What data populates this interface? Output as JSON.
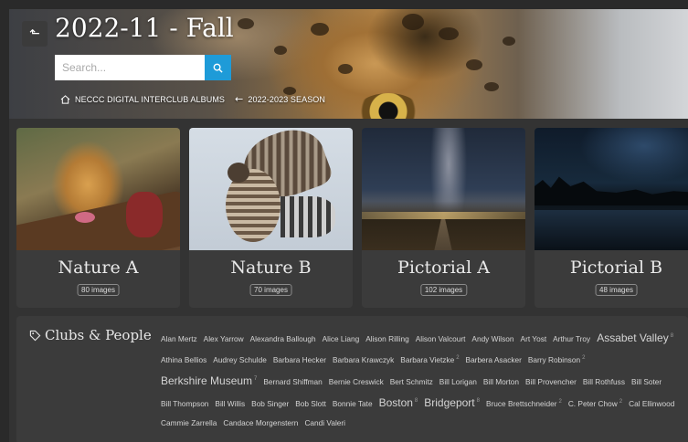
{
  "header": {
    "title": "2022-11 - Fall",
    "back_icon": "arrow-up-left-icon",
    "search_placeholder": "Search...",
    "breadcrumb": {
      "home_label": "NECCC DIGITAL INTERCLUB ALBUMS",
      "parent_label": "2022-2023 SEASON"
    }
  },
  "albums": [
    {
      "name": "Nature A",
      "count": "80 images"
    },
    {
      "name": "Nature B",
      "count": "70 images"
    },
    {
      "name": "Pictorial A",
      "count": "102 images"
    },
    {
      "name": "Pictorial B",
      "count": "48 images"
    }
  ],
  "clubs": {
    "heading": "Clubs & People",
    "tags": [
      {
        "label": "Alan Mertz",
        "count": "",
        "large": false
      },
      {
        "label": "Alex Yarrow",
        "count": "",
        "large": false
      },
      {
        "label": "Alexandra Ballough",
        "count": "",
        "large": false
      },
      {
        "label": "Alice Liang",
        "count": "",
        "large": false
      },
      {
        "label": "Alison Rilling",
        "count": "",
        "large": false
      },
      {
        "label": "Alison Valcourt",
        "count": "",
        "large": false
      },
      {
        "label": "Andy Wilson",
        "count": "",
        "large": false
      },
      {
        "label": "Art Yost",
        "count": "",
        "large": false
      },
      {
        "label": "Arthur Troy",
        "count": "",
        "large": false
      },
      {
        "label": "Assabet Valley",
        "count": "8",
        "large": true
      },
      {
        "label": "Athina Bellios",
        "count": "",
        "large": false
      },
      {
        "label": "Audrey Schulde",
        "count": "",
        "large": false
      },
      {
        "label": "Barbara Hecker",
        "count": "",
        "large": false
      },
      {
        "label": "Barbara Krawczyk",
        "count": "",
        "large": false
      },
      {
        "label": "Barbara Vietzke",
        "count": "2",
        "large": false
      },
      {
        "label": "Barbera Asacker",
        "count": "",
        "large": false
      },
      {
        "label": "Barry Robinson",
        "count": "2",
        "large": false
      },
      {
        "label": "Berkshire Museum",
        "count": "7",
        "large": true
      },
      {
        "label": "Bernard Shiffman",
        "count": "",
        "large": false
      },
      {
        "label": "Bernie Creswick",
        "count": "",
        "large": false
      },
      {
        "label": "Bert Schmitz",
        "count": "",
        "large": false
      },
      {
        "label": "Bill Lorigan",
        "count": "",
        "large": false
      },
      {
        "label": "Bill Morton",
        "count": "",
        "large": false
      },
      {
        "label": "Bill Provencher",
        "count": "",
        "large": false
      },
      {
        "label": "Bill Rothfuss",
        "count": "",
        "large": false
      },
      {
        "label": "Bill Soter",
        "count": "",
        "large": false
      },
      {
        "label": "Bill Thompson",
        "count": "",
        "large": false
      },
      {
        "label": "Bill Willis",
        "count": "",
        "large": false
      },
      {
        "label": "Bob Singer",
        "count": "",
        "large": false
      },
      {
        "label": "Bob Slott",
        "count": "",
        "large": false
      },
      {
        "label": "Bonnie Tate",
        "count": "",
        "large": false
      },
      {
        "label": "Boston",
        "count": "8",
        "large": true
      },
      {
        "label": "Bridgeport",
        "count": "8",
        "large": true
      },
      {
        "label": "Bruce Brettschneider",
        "count": "2",
        "large": false
      },
      {
        "label": "C. Peter Chow",
        "count": "2",
        "large": false
      },
      {
        "label": "Cal Ellinwood",
        "count": "",
        "large": false
      },
      {
        "label": "Cammie Zarrella",
        "count": "",
        "large": false
      },
      {
        "label": "Candace Morgenstern",
        "count": "",
        "large": false
      },
      {
        "label": "Candi Valeri",
        "count": "",
        "large": false
      }
    ]
  },
  "colors": {
    "search_button": "#1e9bd8",
    "card_bg": "#3b3b3b",
    "page_bg": "#333333"
  }
}
